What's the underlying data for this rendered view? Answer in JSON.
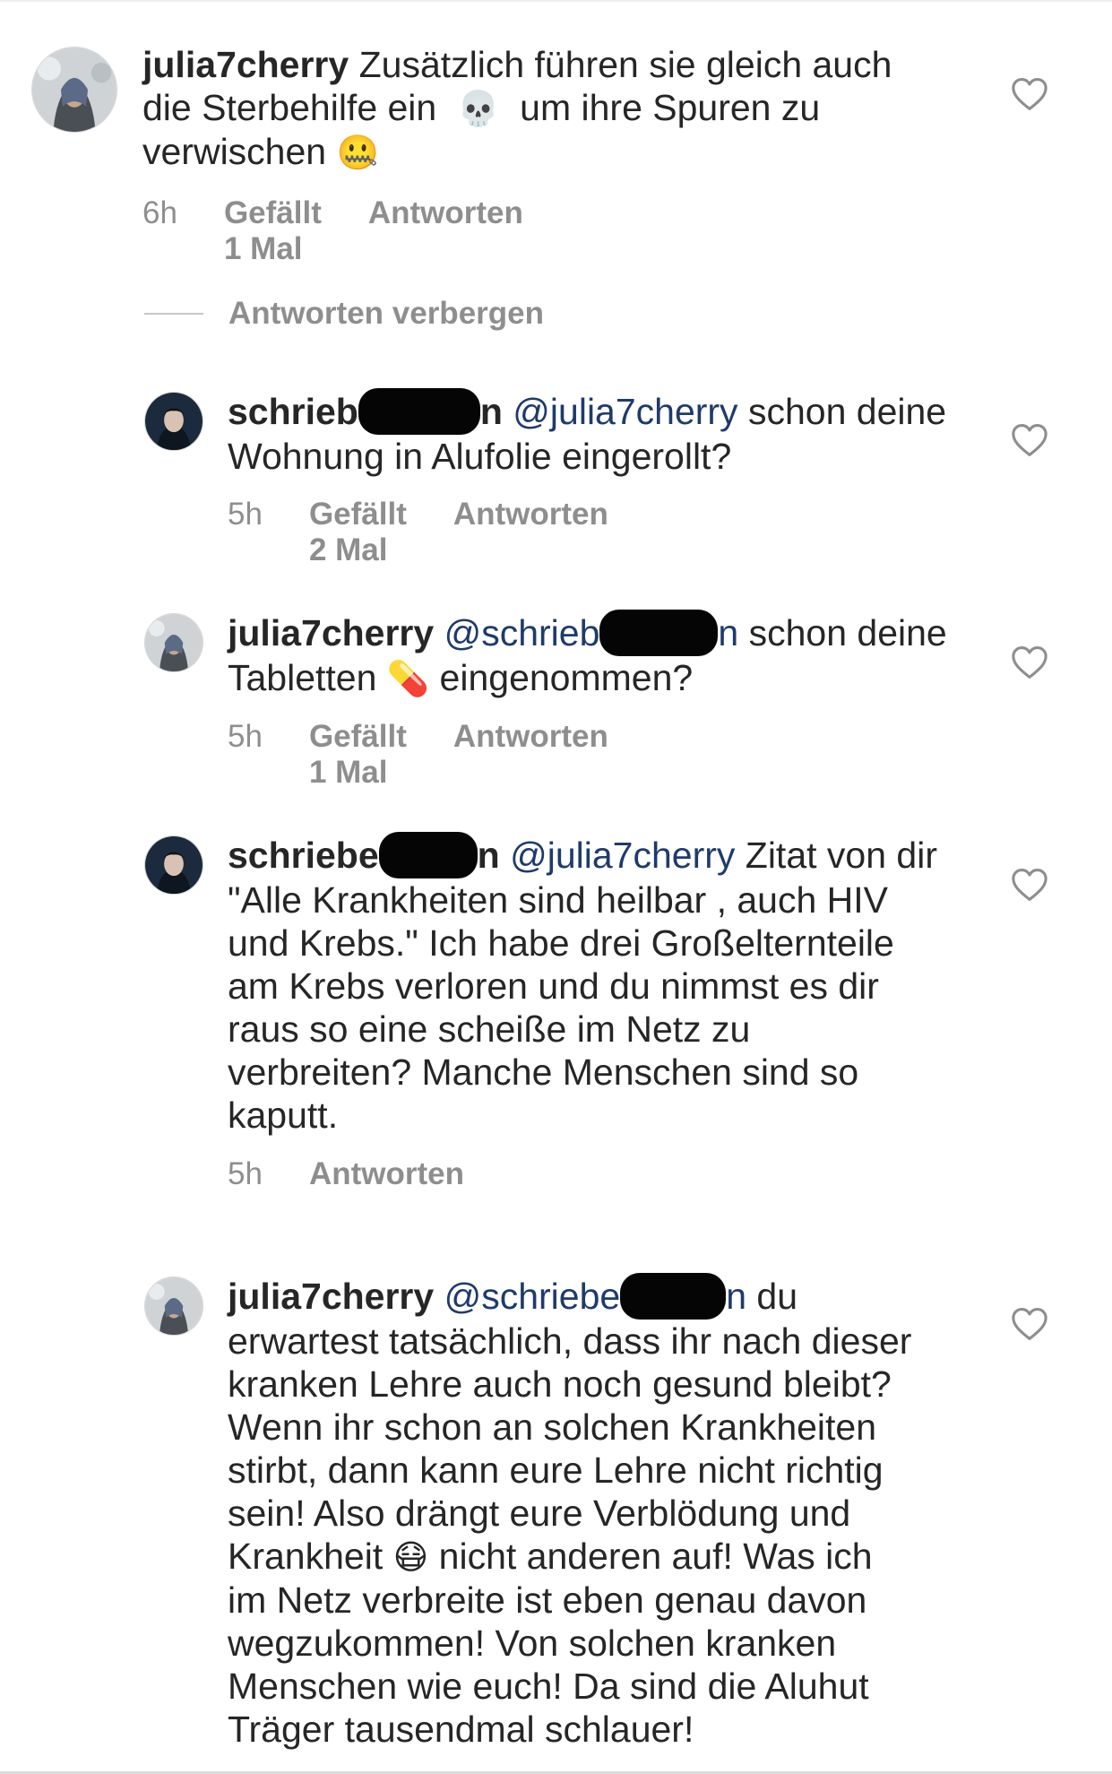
{
  "comments": [
    {
      "username": "julia7cherry",
      "text_1": "Zusätzlich führen sie gleich auch",
      "text_2": "die Sterbehilfe ein",
      "emoji_1": "💀",
      "text_3": "um ihre Spuren zu",
      "text_4": "verwischen",
      "emoji_2": "🤐",
      "time": "6h",
      "likes": "Gefällt 1 Mal",
      "reply": "Antworten"
    },
    {
      "username": "schrieb",
      "username_tail": "n",
      "mention": "@julia7cherry",
      "text_1": "schon deine",
      "text_2": "Wohnung in Alufolie eingerollt?",
      "time": "5h",
      "likes": "Gefällt 2 Mal",
      "reply": "Antworten"
    },
    {
      "username": "julia7cherry",
      "mention": "@schrieb",
      "mention_tail": "n",
      "text_1": "schon deine",
      "text_2": "Tabletten",
      "emoji_1": "💊",
      "text_3": "eingenommen?",
      "time": "5h",
      "likes": "Gefällt 1 Mal",
      "reply": "Antworten"
    },
    {
      "username": "schriebe",
      "username_tail": "n",
      "mention": "@julia7cherry",
      "text_1": "Zitat von dir",
      "lines": [
        "\"Alle Krankheiten sind heilbar , auch HIV",
        "und Krebs.\" Ich habe drei Großelternteile",
        "am Krebs verloren und du nimmst es dir",
        "raus so eine scheiße im Netz zu",
        "verbreiten? Manche Menschen sind so",
        "kaputt."
      ],
      "time": "5h",
      "reply": "Antworten"
    },
    {
      "username": "julia7cherry",
      "mention": "@schriebe",
      "mention_tail": "n",
      "text_1": "du",
      "lines": [
        "erwartest tatsächlich, dass ihr nach dieser",
        "kranken Lehre auch noch gesund bleibt?",
        "Wenn ihr schon an solchen Krankheiten",
        "stirbt, dann kann eure Lehre nicht richtig",
        "sein! Also drängt eure Verblödung und"
      ],
      "line_emoji_pre": "Krankheit",
      "line_emoji": "😷",
      "line_emoji_post": "nicht anderen auf! Was ich",
      "lines_after": [
        "im Netz verbreite ist eben genau davon",
        "wegzukommen! Von solchen kranken",
        "Menschen wie euch! Da sind die Aluhut",
        "Träger tausendmal schlauer!"
      ]
    }
  ],
  "hide_replies": "Antworten verbergen",
  "icons": {
    "like": "heart-outline-icon",
    "avatar_julia": "avatar-julia7cherry",
    "avatar_schrieb": "avatar-schrieb"
  },
  "colors": {
    "text": "#262626",
    "meta": "#8e8e8e",
    "mention": "#1f3b6b"
  }
}
